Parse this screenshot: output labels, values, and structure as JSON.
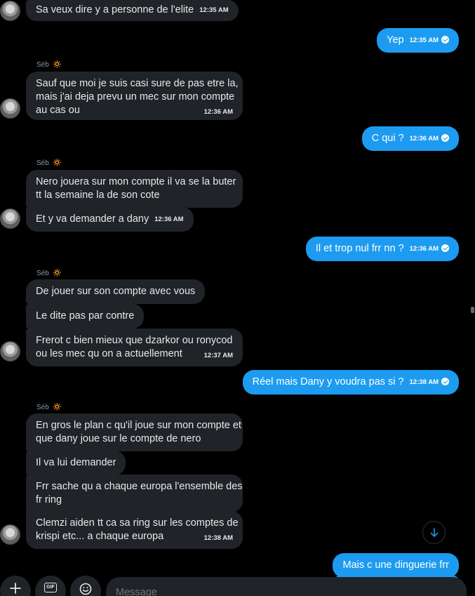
{
  "theme": {
    "incoming_bg": "#202327",
    "outgoing_bg": "#1d9bf0",
    "background": "#000000"
  },
  "sender_name": "Séb",
  "sender_emoji": "🔅",
  "messages": {
    "m1": {
      "text": "Sa veux dire y a personne de l'elite",
      "time": "12:35 AM"
    },
    "m2": {
      "text": "Yep",
      "time": "12:35 AM"
    },
    "m3": {
      "text": "Sauf que moi je suis casi sure de pas etre la,",
      "text2": "mais j'ai deja prevu un mec sur mon compte",
      "text3": "au cas ou",
      "time": "12:36 AM"
    },
    "m4": {
      "text": "C qui ?",
      "time": "12:36 AM"
    },
    "m5": {
      "text": "Nero jouera sur mon compte il va se la buter",
      "text2": "tt la semaine la de son cote"
    },
    "m6": {
      "text": "Et y va demander a dany",
      "time": "12:36 AM"
    },
    "m7": {
      "text": "Il et trop nul frr nn ?",
      "time": "12:36 AM"
    },
    "m8": {
      "text": "De jouer sur son compte avec vous"
    },
    "m9": {
      "text": "Le dite pas par contre"
    },
    "m10": {
      "text": "Frerot c bien mieux que dzarkor ou ronycod",
      "text2": "ou les mec qu on a actuellement",
      "time": "12:37 AM"
    },
    "m11": {
      "text": "Réel mais Dany y voudra pas si ?",
      "time": "12:38 AM"
    },
    "m12": {
      "text": "En gros le plan c qu'il joue sur mon compte et",
      "text2": "que dany joue sur le compte de nero"
    },
    "m13": {
      "text": "Il va lui demander"
    },
    "m14": {
      "text": "Frr sache qu a chaque europa l'ensemble des",
      "text2": "fr ring"
    },
    "m15": {
      "text": "Clemzi aiden tt ca sa ring sur les comptes de",
      "text2": "krispi etc... a chaque europa",
      "time": "12:38 AM"
    },
    "m16": {
      "text": "Mais c une dinguerie frr"
    }
  },
  "composer": {
    "placeholder": "Message",
    "gif_label": "GIF"
  }
}
